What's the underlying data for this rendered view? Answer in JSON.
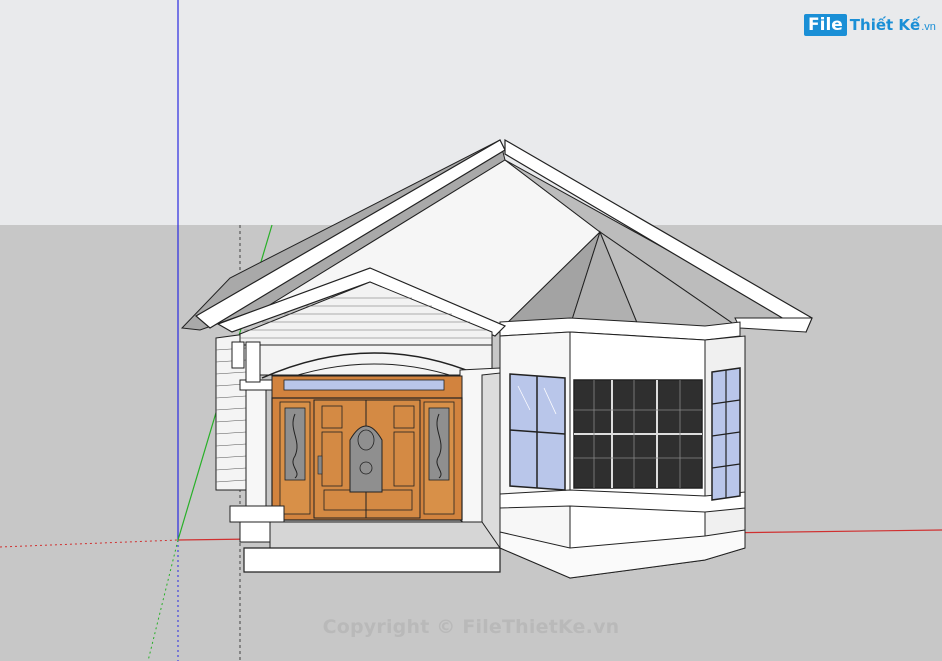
{
  "watermark": {
    "logo_file": "File",
    "logo_name": "Thiết Kế",
    "logo_domain": ".vn",
    "copyright": "Copyright © FileThietKe.vn"
  },
  "colors": {
    "sky": "#e9eaec",
    "ground": "#c7c7c7",
    "axis_blue": "#2a2ae0",
    "axis_red": "#d03030",
    "axis_green": "#28b028",
    "door_wood": "#d2833e",
    "glass": "#b9c6ea",
    "roof_fill": "#ffffff",
    "roof_slope": "#a9a9a9",
    "brand": "#1a8fd6"
  }
}
